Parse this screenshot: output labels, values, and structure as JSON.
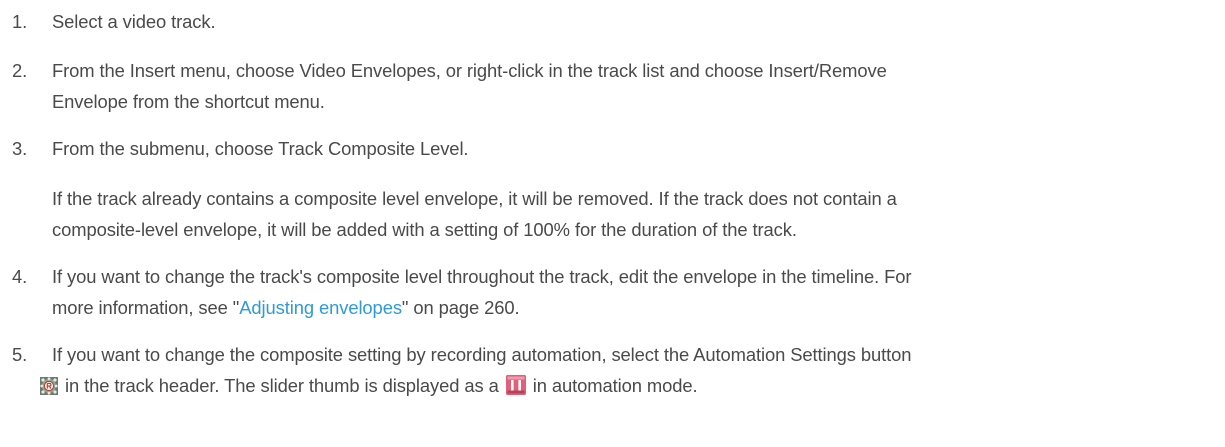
{
  "steps": [
    {
      "num": "1.",
      "text": "Select a video track."
    },
    {
      "num": "2.",
      "line1": "From the Insert menu, choose Video Envelopes, or right-click in the track list and choose Insert/Remove",
      "line2": "Envelope from the shortcut menu."
    },
    {
      "num": "3.",
      "text": "From the submenu, choose Track Composite Level."
    },
    {
      "num": "4.",
      "line1": "If you want to change the track's composite level throughout the track, edit the envelope in the timeline. For",
      "line2_pre": "more information, see \"",
      "link": "Adjusting envelopes",
      "line2_post": "\" on page 260."
    },
    {
      "num": "5.",
      "line1": "If you want to change the composite setting by recording automation, select the Automation Settings button",
      "line2_a": " in the track header. The slider thumb is displayed as a ",
      "line2_b": " in automation mode."
    }
  ],
  "note": {
    "line1": "If the track already contains a composite level envelope, it will be removed. If the track does not contain a",
    "line2": "composite-level envelope, it will be added with a setting of 100% for the duration of the track."
  },
  "icons": {
    "automation": "automation-settings-icon",
    "slider_thumb": "automation-slider-thumb-icon"
  },
  "colors": {
    "text": "#4a4a4a",
    "link": "#2e9bd6",
    "thumb": "#e0607a"
  }
}
